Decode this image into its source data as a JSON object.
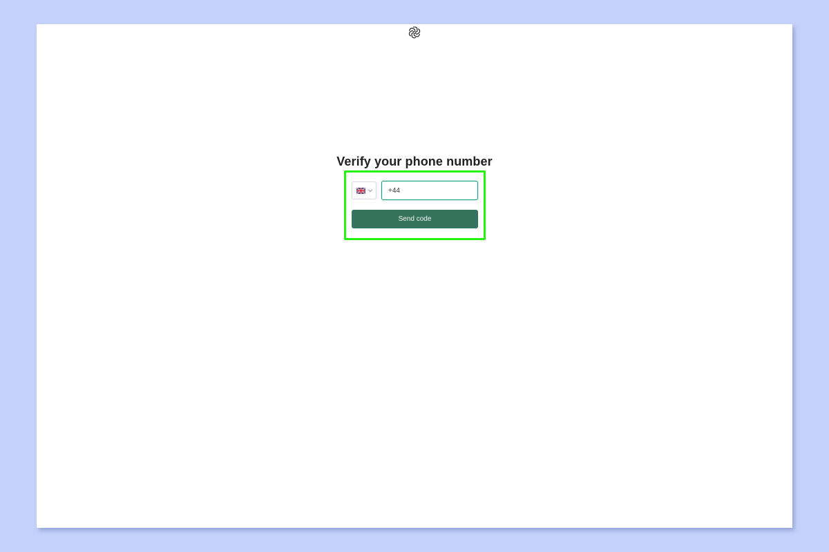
{
  "page": {
    "title": "Verify your phone number"
  },
  "icons": {
    "logo": "openai-logo-icon",
    "flag": "uk-flag-icon",
    "dropdown": "chevron-down-icon"
  },
  "form": {
    "phone_value": "+44",
    "send_label": "Send code"
  },
  "colors": {
    "button": "#35735d",
    "input_border": "#10a37f",
    "highlight": "#25f20e",
    "background": "#c4d2fb"
  }
}
